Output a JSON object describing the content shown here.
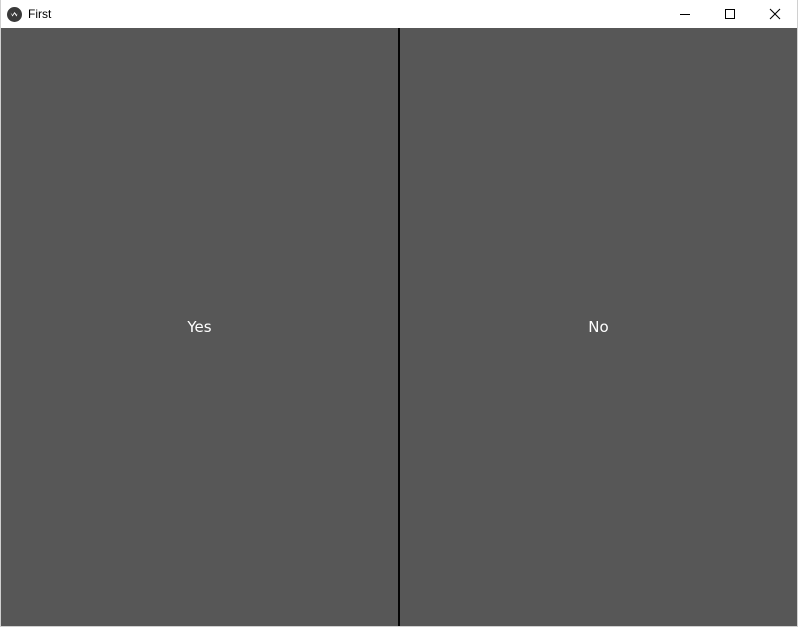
{
  "window": {
    "title": "First",
    "app_icon": "kivy-logo-icon",
    "controls": [
      "minimize-icon",
      "maximize-icon",
      "close-icon"
    ]
  },
  "buttons": {
    "left_label": "Yes",
    "right_label": "No"
  },
  "colors": {
    "button_background": "#575757",
    "divider": "#050505",
    "titlebar": "#ffffff",
    "label_text": "#ffffff"
  }
}
